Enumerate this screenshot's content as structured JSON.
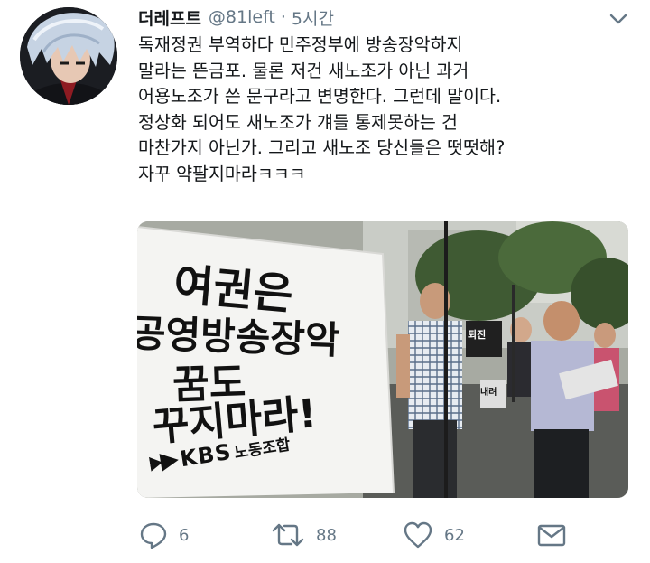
{
  "tweet": {
    "display_name": "더레프트",
    "handle": "@81left",
    "separator": "·",
    "time": "5시간",
    "lines": [
      "독재정권 부역하다 민주정부에 방송장악하지",
      "말라는 뜬금포. 물론 저건 새노조가 아닌 과거",
      "어용노조가 쓴 문구라고 변명한다. 그런데 말이다.",
      "정상화 되어도 새노조가 걔들 통제못하는 건",
      "마찬가지 아닌가. 그리고 새노조 당신들은 떳떳해?",
      "자꾸 약팔지마라ㅋㅋㅋ"
    ]
  },
  "media": {
    "sign_lines": [
      "여권은",
      "공영방송장악",
      "꿈도",
      "꾸지마라!"
    ],
    "union_logo": "KBS",
    "union_name": "노동조합",
    "protest_sign": "퇴진",
    "protest_sign2": "내려"
  },
  "actions": {
    "reply_count": "6",
    "retweet_count": "88",
    "like_count": "62"
  },
  "colors": {
    "text": "#14171a",
    "secondary": "#657786",
    "icon": "#657786"
  }
}
